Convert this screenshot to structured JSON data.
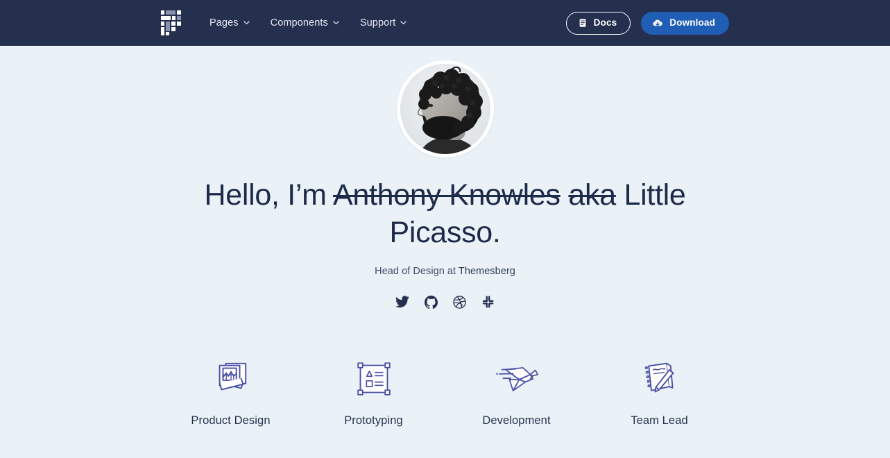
{
  "navbar": {
    "logo_name": "themesberg-pixel-logo",
    "links": [
      {
        "label": "Pages",
        "icon": "chevron-down-icon"
      },
      {
        "label": "Components",
        "icon": "chevron-down-icon"
      },
      {
        "label": "Support",
        "icon": "chevron-down-icon"
      }
    ],
    "docs_button": {
      "label": "Docs",
      "icon": "book-icon"
    },
    "download_button": {
      "label": "Download",
      "icon": "cloud-download-icon"
    },
    "background_color": "#252f4e",
    "download_color": "#1f5eb4"
  },
  "hero": {
    "avatar_alt": "portrait-photo",
    "title_line1_prefix": "Hello, I’m ",
    "title_line1_strike": "Anthony Knowles",
    "title_line2_strike": "aka",
    "title_line2_rest": " Little Picasso.",
    "subtitle_prefix": "Head of Design at ",
    "subtitle_company": "Themesberg",
    "socials": [
      {
        "name": "twitter-icon",
        "label": "Twitter"
      },
      {
        "name": "github-icon",
        "label": "GitHub"
      },
      {
        "name": "dribbble-icon",
        "label": "Dribbble"
      },
      {
        "name": "slack-icon",
        "label": "Slack"
      }
    ],
    "background_color": "#eaf2f7",
    "text_color": "#1e2a4a"
  },
  "features": [
    {
      "label": "Product Design",
      "icon": "stacked-photos-icon"
    },
    {
      "label": "Prototyping",
      "icon": "wireframe-box-icon"
    },
    {
      "label": "Development",
      "icon": "origami-bird-icon"
    },
    {
      "label": "Team Lead",
      "icon": "notepad-pencil-icon"
    }
  ],
  "accent_icon_color": "#4a4fa5"
}
